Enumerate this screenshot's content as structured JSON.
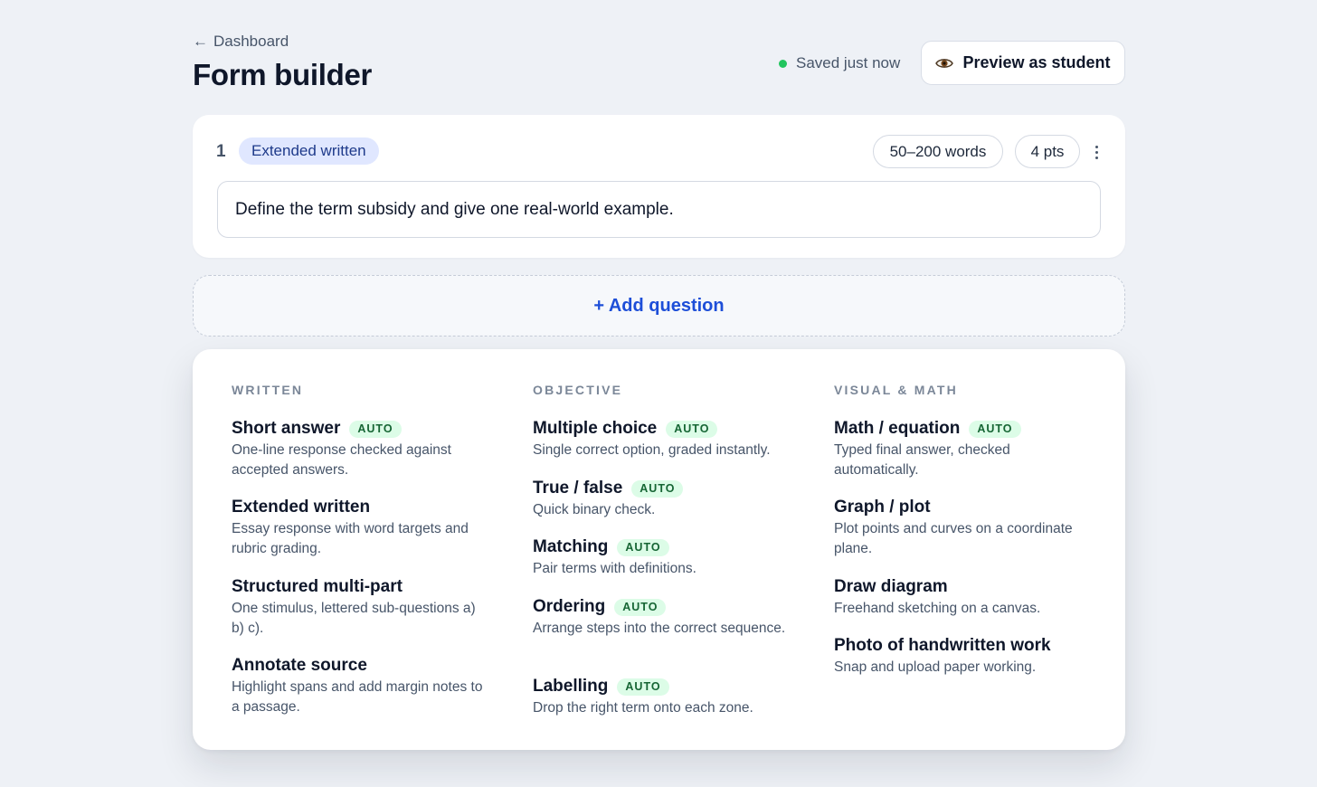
{
  "header": {
    "back_arrow": "←",
    "back_label": "Dashboard",
    "title": "Form builder",
    "saved_status": "Saved just now",
    "preview_label": "Preview as student"
  },
  "question": {
    "number": "1",
    "type_badge": "Extended written",
    "word_range": "50–200 words",
    "points": "4 pts",
    "prompt": "Define the term subsidy and give one real-world example."
  },
  "add_question_label": "+ Add question",
  "menu": {
    "columns": [
      {
        "heading": "WRITTEN",
        "options": [
          {
            "name": "Short answer",
            "auto": "AUTO",
            "desc": "One-line response checked against accepted answers."
          },
          {
            "name": "Extended written",
            "auto": "",
            "desc": "Essay response with word targets and rubric grading."
          },
          {
            "name": "Structured multi-part",
            "auto": "",
            "desc": "One stimulus, lettered sub-questions a) b) c)."
          },
          {
            "name": "Annotate source",
            "auto": "",
            "desc": "Highlight spans and add margin notes to a passage."
          }
        ]
      },
      {
        "heading": "OBJECTIVE",
        "options": [
          {
            "name": "Multiple choice",
            "auto": "AUTO",
            "desc": "Single correct option, graded instantly."
          },
          {
            "name": "True / false",
            "auto": "AUTO",
            "desc": "Quick binary check."
          },
          {
            "name": "Matching",
            "auto": "AUTO",
            "desc": "Pair terms with definitions."
          },
          {
            "name": "Ordering",
            "auto": "AUTO",
            "desc": "Arrange steps into the correct sequence."
          },
          {
            "name": "Labelling",
            "auto": "AUTO",
            "desc": "Drop the right term onto each zone."
          }
        ]
      },
      {
        "heading": "VISUAL & MATH",
        "options": [
          {
            "name": "Math / equation",
            "auto": "AUTO",
            "desc": "Typed final answer, checked automatically."
          },
          {
            "name": "Graph / plot",
            "auto": "",
            "desc": "Plot points and curves on a coordinate plane."
          },
          {
            "name": "Draw diagram",
            "auto": "",
            "desc": "Freehand sketching on a canvas."
          },
          {
            "name": "Photo of handwritten work",
            "auto": "",
            "desc": "Snap and upload paper working."
          }
        ]
      }
    ]
  },
  "colors": {
    "accent": "#1d4ed8",
    "saved_dot": "#22c55e",
    "auto_badge_bg": "#dcfce7",
    "auto_badge_text": "#166534",
    "type_badge_bg": "#e0e7ff"
  },
  "icons": {
    "preview": "eye-icon",
    "more": "more-vertical-icon",
    "back": "arrow-left-icon"
  }
}
